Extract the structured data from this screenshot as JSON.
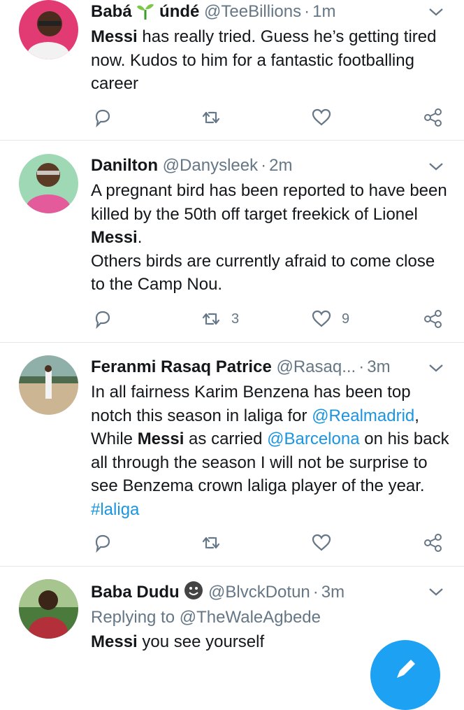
{
  "tweets": [
    {
      "name": "Babá",
      "name_suffix": "úndé",
      "handle": "@TeeBillions",
      "time": "1m",
      "body": [
        {
          "t": "Messi",
          "b": true
        },
        {
          "t": " has really tried. Guess he’s getting tired now. Kudos to him for a fantastic footballing career"
        }
      ],
      "retweets": "",
      "likes": ""
    },
    {
      "name": "Danilton",
      "handle": "@Danysleek",
      "time": "2m",
      "body": [
        {
          "t": "A pregnant bird has been reported to have been killed by the 50th off target freekick of Lionel "
        },
        {
          "t": "Messi",
          "b": true
        },
        {
          "t": "."
        },
        {
          "br": true
        },
        {
          "t": "Others birds are currently afraid to come close to the Camp Nou."
        }
      ],
      "retweets": "3",
      "likes": "9"
    },
    {
      "name": "Feranmi Rasaq Patrice",
      "handle": "@Rasaq...",
      "time": "3m",
      "body": [
        {
          "t": "In all fairness Karim Benzena has been top notch this season in laliga for "
        },
        {
          "t": "@Realmadrid",
          "link": true
        },
        {
          "t": ", While "
        },
        {
          "t": "Messi",
          "b": true
        },
        {
          "t": " as carried "
        },
        {
          "t": "@Barcelona",
          "link": true
        },
        {
          "t": " on his back all through the season I will not be surprise to see Benzema crown laliga player of the year. "
        },
        {
          "t": "#laliga",
          "link": true
        }
      ],
      "retweets": "",
      "likes": ""
    },
    {
      "name": "Baba Dudu",
      "handle": "@BlvckDotun",
      "time": "3m",
      "replying_label": "Replying to",
      "replying_to": "@TheWaleAgbede",
      "body": [
        {
          "t": "Messi",
          "b": true
        },
        {
          "t": " you see yourself"
        }
      ]
    }
  ],
  "icons": {
    "reply": "reply-icon",
    "retweet": "retweet-icon",
    "like": "heart-icon",
    "share": "share-icon",
    "menu": "chevron-down-icon",
    "compose": "compose-icon"
  },
  "colors": {
    "link": "#1b95e0",
    "secondary": "#657786",
    "fab": "#1da1f2"
  }
}
